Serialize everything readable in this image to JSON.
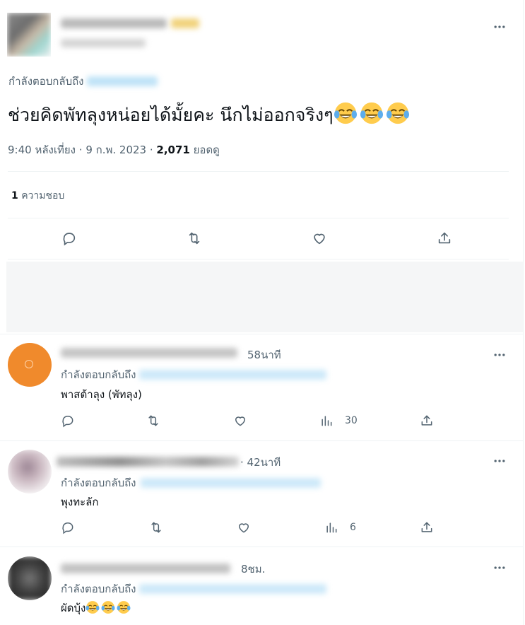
{
  "main_tweet": {
    "replying_to_label": "กำลังตอบกลับถึง",
    "text": "ช่วยคิดพัทลุงหน่อยได้มั้ยคะ นึกไม่ออกจริงๆ",
    "time": "9:40 หลังเที่ยง",
    "date": "9 ก.พ. 2023",
    "views_count": "2,071",
    "views_label": "ยอดดู",
    "likes_count": "1",
    "likes_label": "ความชอบ",
    "more_icon": "more-horizontal-icon",
    "emoji_icon": "tears-of-joy-emoji"
  },
  "replies": [
    {
      "time": "58นาที",
      "replying_to_label": "กำลังตอบกลับถึง",
      "text": "พาสต้าลุง (พัทลุง)",
      "views": "30",
      "avatar_color": "#f08a2c"
    },
    {
      "time": "· 42นาที",
      "replying_to_label": "กำลังตอบกลับถึง",
      "text": "พุงทะลัก",
      "views": "6",
      "avatar_color": "#b5a0a8"
    },
    {
      "time": "8ชม.",
      "replying_to_label": "กำลังตอบกลับถึง",
      "text": "ผัดบุ้ง",
      "avatar_color": "#4a4a4a"
    }
  ],
  "colors": {
    "text": "#0f1419",
    "muted": "#536471",
    "divider": "#eff3f4",
    "link": "#1d9bf0"
  }
}
